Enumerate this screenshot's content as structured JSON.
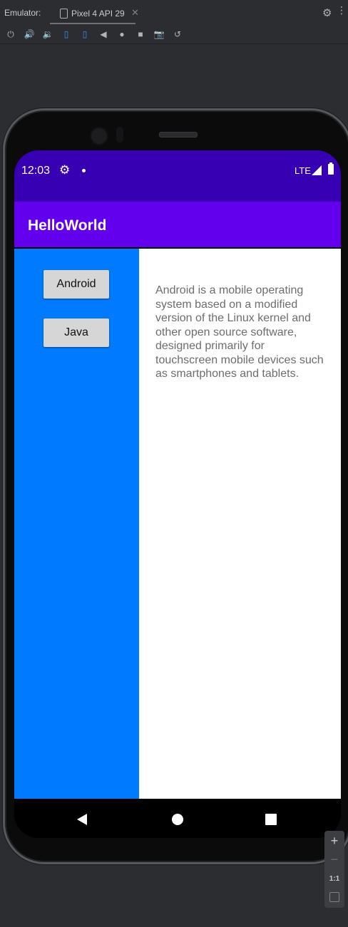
{
  "emulator": {
    "title": "Emulator:",
    "tab_label": "Pixel 4 API 29",
    "tab_close": "✕",
    "settings_icon": "⚙",
    "more_icon": "⋮",
    "toolbar": {
      "power": "⏻",
      "volume_up": "🔊",
      "volume_down": "🔉",
      "rotate_left": "▯",
      "rotate_right": "▯",
      "back": "◀",
      "home": "●",
      "overview": "■",
      "screenshot": "📷",
      "snapshot": "↺"
    }
  },
  "status_bar": {
    "time": "12:03",
    "settings_icon": "⚙",
    "network": "LTE",
    "colors": {
      "status_bar": "#3700b3"
    }
  },
  "app_bar": {
    "title": "HelloWorld",
    "color": "#6200ee"
  },
  "main": {
    "left_pane_color": "#007aff",
    "buttons": [
      {
        "label": "Android"
      },
      {
        "label": "Java"
      }
    ],
    "description": "Android is a mobile operating system based on a modified version of the Linux kernel and other open source software, designed primarily for touchscreen mobile devices such as smartphones and tablets."
  },
  "zoom_controls": {
    "zoom_in": "+",
    "zoom_out": "−",
    "actual_size": "1:1"
  }
}
